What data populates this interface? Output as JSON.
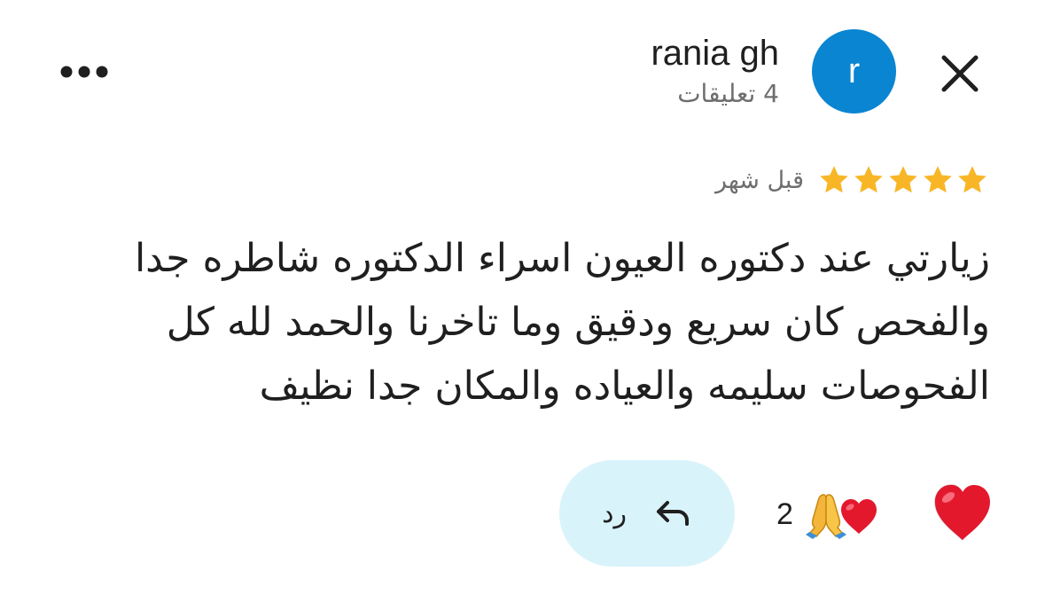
{
  "header": {
    "author_name": "rania gh",
    "author_meta": "4 تعليقات",
    "avatar_letter": "r",
    "avatar_color": "#0a85d1",
    "close_icon": "close-icon",
    "more_icon": "more-horizontal-icon"
  },
  "review": {
    "rating": 5,
    "max_rating": 5,
    "star_color": "#f8b626",
    "date": "قبل شهر",
    "text": "زيارتي عند دكتوره العيون اسراء الدكتوره شاطره جدا والفحص كان سريع ودقيق وما تاخرنا والحمد لله كل الفحوصات سليمه والعياده والمكان جدا نظيف"
  },
  "footer": {
    "reply_label": "رد",
    "reply_icon": "reply-arrow-icon",
    "reply_bg": "#d9f3fb",
    "reaction_count": "2",
    "reaction_icons": [
      "pray-emoji",
      "heart-emoji"
    ],
    "react_icon": "heart-emoji"
  }
}
